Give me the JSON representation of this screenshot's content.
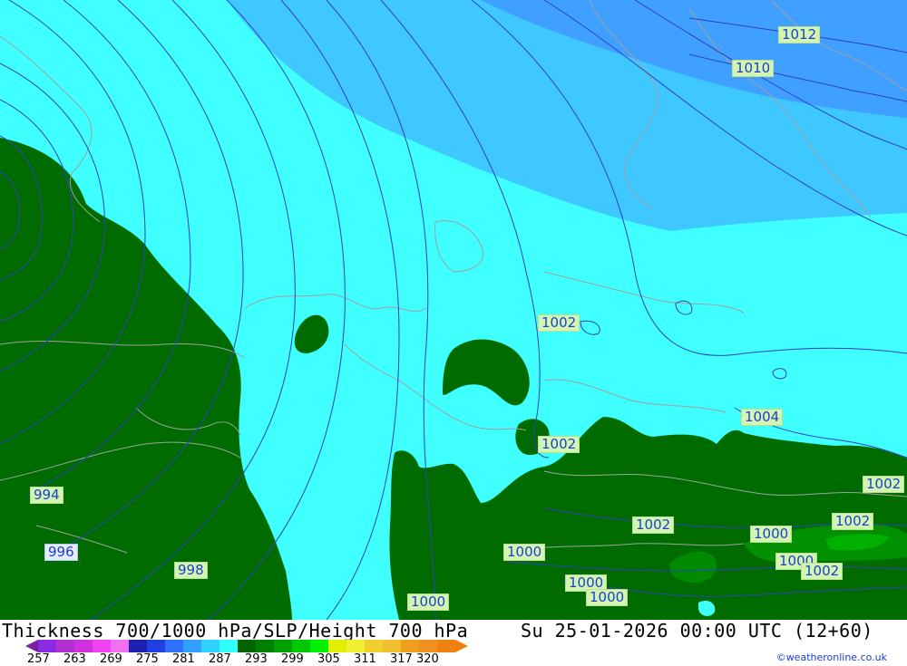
{
  "map": {
    "colors": {
      "very_light_cyan": "#3ff5ff",
      "cyan": "#3fffff",
      "light_blue": "#3fbfff",
      "mid_blue": "#3f9fff",
      "dark_green": "#006400",
      "green": "#009600",
      "isobar": "#3040c0",
      "coast": "#a0a0a0"
    },
    "isobar_labels": [
      {
        "text": "1012",
        "style": "green"
      },
      {
        "text": "1010",
        "style": "green"
      },
      {
        "text": "1002",
        "style": "green"
      },
      {
        "text": "1004",
        "style": "green"
      },
      {
        "text": "1002",
        "style": "green"
      },
      {
        "text": "1002",
        "style": "green"
      },
      {
        "text": "994",
        "style": "green"
      },
      {
        "text": "996",
        "style": "blue"
      },
      {
        "text": "998",
        "style": "green"
      },
      {
        "text": "1002",
        "style": "green"
      },
      {
        "text": "1002",
        "style": "green"
      },
      {
        "text": "1000",
        "style": "green"
      },
      {
        "text": "1000",
        "style": "green"
      },
      {
        "text": "1000",
        "style": "green"
      },
      {
        "text": "1000",
        "style": "green"
      },
      {
        "text": "1002",
        "style": "green"
      },
      {
        "text": "1000",
        "style": "green"
      },
      {
        "text": "1000",
        "style": "green"
      }
    ]
  },
  "footer": {
    "title": "Thickness 700/1000 hPa/SLP/Height 700 hPa",
    "timestamp": "Su 25-01-2026 00:00 UTC (12+60)",
    "credit": "©weatheronline.co.uk",
    "legend": {
      "colors": [
        "#8a2be2",
        "#b030d0",
        "#d030e0",
        "#f040f0",
        "#f070f0",
        "#2020b0",
        "#2040e0",
        "#3070ff",
        "#30a0ff",
        "#30d0ff",
        "#30ffff",
        "#006400",
        "#008000",
        "#00a000",
        "#00c800",
        "#00f000",
        "#e0f000",
        "#f0f030",
        "#f0d030",
        "#f0c030",
        "#f0a020",
        "#f09020",
        "#f08010"
      ],
      "ticks": [
        "257",
        "263",
        "269",
        "275",
        "281",
        "287",
        "293",
        "299",
        "305",
        "311",
        "317",
        "320"
      ]
    }
  }
}
